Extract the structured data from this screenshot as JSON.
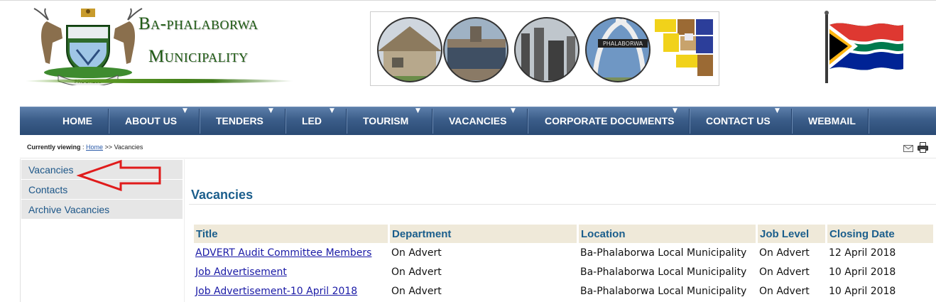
{
  "header": {
    "logo_line1": "Ba-phalaborwa",
    "logo_line2": "Municipality",
    "crest_motto": "PROGRESS",
    "banner_sign": "PHALABORWA"
  },
  "nav": {
    "items": [
      {
        "label": "HOME",
        "dropdown": false
      },
      {
        "label": "ABOUT US",
        "dropdown": true
      },
      {
        "label": "TENDERS",
        "dropdown": true
      },
      {
        "label": "LED",
        "dropdown": true
      },
      {
        "label": "TOURISM",
        "dropdown": true
      },
      {
        "label": "VACANCIES",
        "dropdown": true
      },
      {
        "label": "CORPORATE DOCUMENTS",
        "dropdown": true
      },
      {
        "label": "CONTACT US",
        "dropdown": true
      },
      {
        "label": "WEBMAIL",
        "dropdown": false
      }
    ],
    "caret": "▼"
  },
  "breadcrumb": {
    "prefix": "Currently viewing",
    "separator_colon": " : ",
    "home": "Home",
    "separator": " >> ",
    "current": "Vacancies"
  },
  "sidemenu": {
    "items": [
      "Vacancies",
      "Contacts",
      "Archive Vacancies"
    ]
  },
  "content": {
    "title": "Vacancies",
    "table": {
      "headers": [
        "Title",
        "Department",
        "Location",
        "Job Level",
        "Closing Date"
      ],
      "rows": [
        [
          "ADVERT Audit Committee Members",
          "On Advert",
          "Ba-Phalaborwa Local Municipality",
          "On Advert",
          "12 April 2018"
        ],
        [
          "Job Advertisement",
          "On Advert",
          "Ba-Phalaborwa Local Municipality",
          "On Advert",
          "10 April 2018"
        ],
        [
          "Job Advertisement-10 April 2018",
          "On Advert",
          "Ba-Phalaborwa Local Municipality",
          "On Advert",
          "10 April 2018"
        ]
      ]
    }
  },
  "icons": [
    "mail-icon",
    "print-icon"
  ],
  "colors": {
    "nav_bg": "#3b5d89",
    "link": "#1a1aa6",
    "heading": "#1b5e8c",
    "logo_green": "#1f5b14",
    "annotation_arrow": "#e01b1b"
  }
}
